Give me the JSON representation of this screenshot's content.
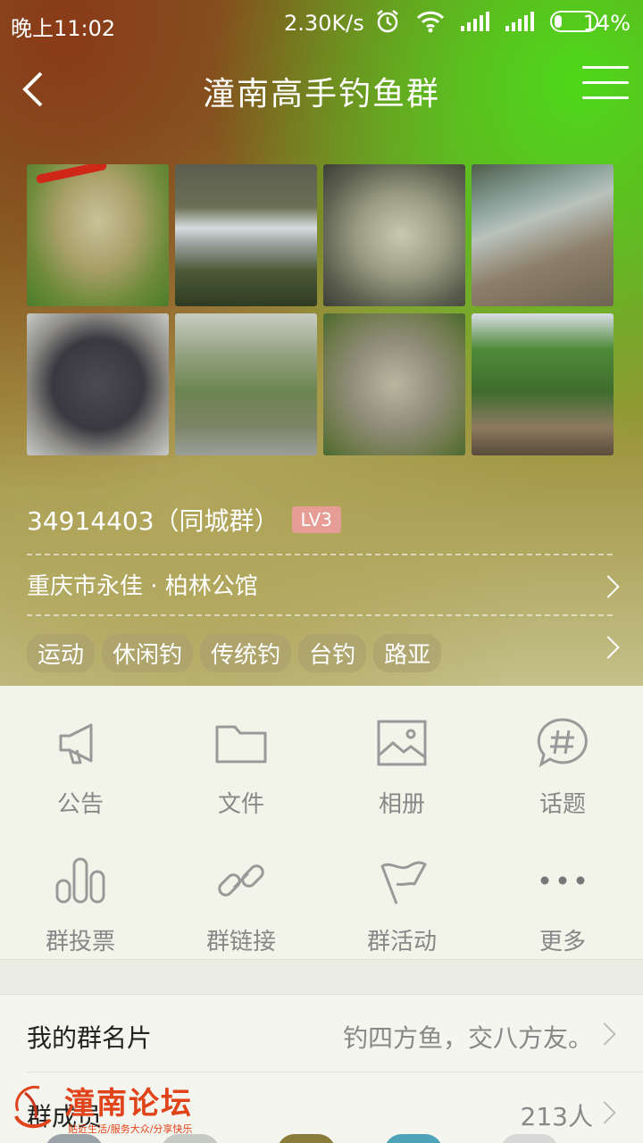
{
  "status_bar": {
    "time": "晚上11:02",
    "speed": "2.30K/s",
    "battery": "14%"
  },
  "header": {
    "title": "潼南高手钓鱼群"
  },
  "group": {
    "id_text": "34914403（同城群）",
    "level": "LV3",
    "location": "重庆市永佳 · 柏林公馆",
    "tags": [
      "运动",
      "休闲钓",
      "传统钓",
      "台钓",
      "路亚"
    ]
  },
  "functions": [
    {
      "label": "公告",
      "icon": "megaphone-icon"
    },
    {
      "label": "文件",
      "icon": "folder-icon"
    },
    {
      "label": "相册",
      "icon": "image-icon"
    },
    {
      "label": "话题",
      "icon": "hashtag-bubble-icon"
    },
    {
      "label": "群投票",
      "icon": "bar-chart-icon"
    },
    {
      "label": "群链接",
      "icon": "link-icon"
    },
    {
      "label": "群活动",
      "icon": "flag-icon"
    },
    {
      "label": "更多",
      "icon": "more-dots-icon"
    }
  ],
  "rows": {
    "card_label": "我的群名片",
    "card_value": "钓四方鱼，交八方友。",
    "members_label": "群成员",
    "members_value": "213人"
  },
  "watermark": {
    "brand": "潼南论坛",
    "slogan": "贴近生活/服务大众/分享快乐"
  },
  "colors": {
    "accent_green": "#4ed81a",
    "level_badge": "#e59d95",
    "watermark": "#e1441a"
  }
}
